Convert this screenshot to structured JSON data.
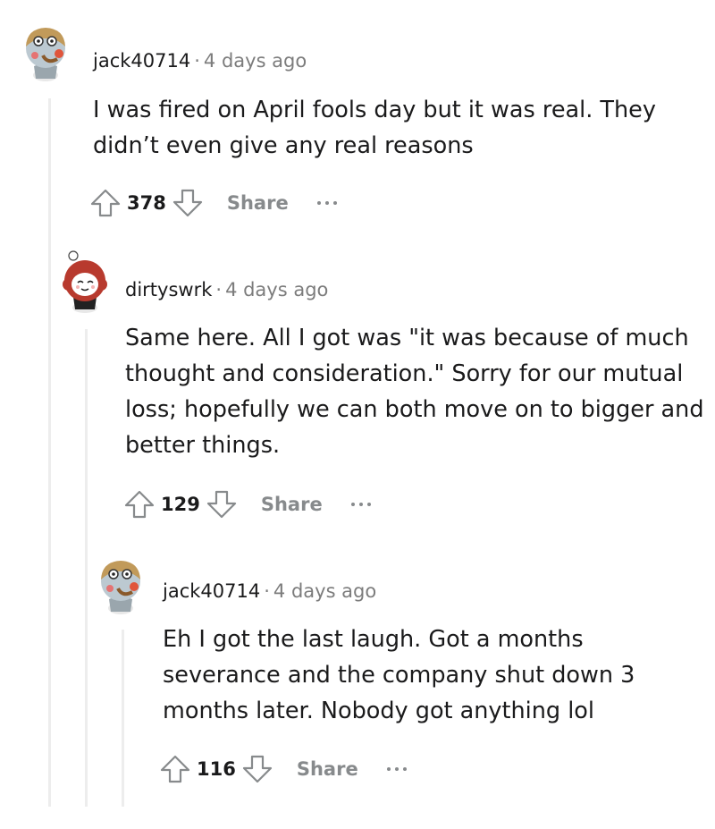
{
  "comments": [
    {
      "username": "jack40714",
      "separator": "·",
      "time": "4 days ago",
      "body": "I was fired on April fools day but it was real. They didn’t even give any real reasons",
      "score": "378",
      "share_label": "Share",
      "avatar_icon": "snoo-avatar-pilot-icon"
    },
    {
      "username": "dirtyswrk",
      "separator": "·",
      "time": "4 days ago",
      "body": "Same here. All I got was \"it was because of much thought and consideration.\" Sorry for our mutual loss; hopefully we can both move on to bigger and better things.",
      "score": "129",
      "share_label": "Share",
      "avatar_icon": "snoo-avatar-redhead-icon"
    },
    {
      "username": "jack40714",
      "separator": "·",
      "time": "4 days ago",
      "body": "Eh I got the last laugh. Got a months severance and the company shut down 3 months later. Nobody got anything lol",
      "score": "116",
      "share_label": "Share",
      "avatar_icon": "snoo-avatar-pilot-icon"
    }
  ],
  "colors": {
    "text": "#1a1a1b",
    "muted": "#7c7c7c",
    "action": "#878a8c",
    "thread_line": "#ededed"
  }
}
